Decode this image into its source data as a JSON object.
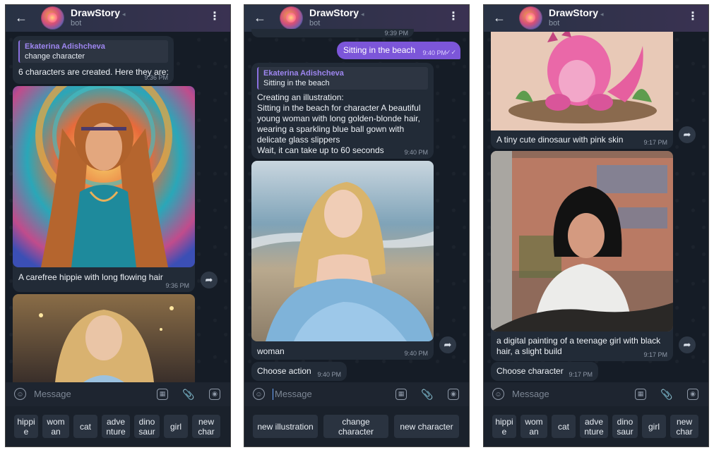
{
  "app": {
    "title": "DrawStory",
    "subtitle": "bot",
    "input_placeholder": "Message"
  },
  "screens": [
    {
      "messages": {
        "m1_quote_name": "Ekaterina Adishcheva",
        "m1_quote_text": "change character",
        "m1_text": "6 characters are created. Here they are:",
        "m1_time": "9:36 PM",
        "m2_caption": "A carefree hippie with long flowing hair",
        "m2_time": "9:36 PM"
      },
      "keyboard": [
        "hippi\ne",
        "wom\nan",
        "cat",
        "adve\nnture",
        "dino\nsaur",
        "girl",
        "new\nchar"
      ]
    },
    {
      "messages": {
        "m0_time": "9:39 PM",
        "m1_text": "Sitting in the beach",
        "m1_time": "9:40 PM",
        "m2_quote_name": "Ekaterina Adishcheva",
        "m2_quote_text": "Sitting in the beach",
        "m2_lines": [
          "Creating an illustration:",
          "Sitting in the beach for character A beautiful",
          "young woman with long golden-blonde hair,",
          "wearing a sparkling blue ball gown with",
          "delicate glass slippers",
          "Wait, it can take up to 60 seconds"
        ],
        "m2_time": "9:40 PM",
        "m3_caption": "woman",
        "m3_time": "9:40 PM",
        "m4_text": "Choose action",
        "m4_time": "9:40 PM"
      },
      "keyboard": [
        "new illustration",
        "change\ncharacter",
        "new character"
      ]
    },
    {
      "messages": {
        "m1_caption": "A tiny cute dinosaur with pink skin",
        "m1_time": "9:17 PM",
        "m2_caption_l1": "a digital painting of a teenage girl with black",
        "m2_caption_l2": "hair, a slight build",
        "m2_time": "9:17 PM",
        "m3_text": "Choose character",
        "m3_time": "9:17 PM"
      },
      "keyboard": [
        "hippi\ne",
        "wom\nan",
        "cat",
        "adve\nnture",
        "dino\nsaur",
        "girl",
        "new\nchar"
      ]
    }
  ],
  "colors": {
    "background": "#151c26",
    "header": "#283244",
    "bubble_in": "#222b37",
    "bubble_out": "#7c56d9",
    "accent": "#8a70e0"
  },
  "icons": [
    "back-arrow-icon",
    "more-vertical-icon",
    "emoji-icon",
    "sticker-icon",
    "attach-icon",
    "camera-icon",
    "share-icon",
    "double-check-icon"
  ]
}
